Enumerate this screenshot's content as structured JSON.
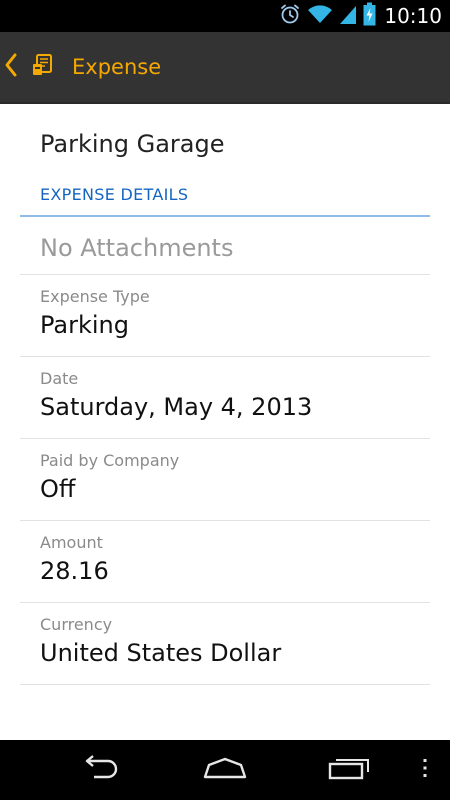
{
  "status_bar": {
    "time": "10:10",
    "icons": [
      "alarm-icon",
      "wifi-icon",
      "signal-icon",
      "battery-charging-icon"
    ]
  },
  "action_bar": {
    "title": "Expense",
    "title_color": "#f5a800",
    "icons": [
      "back-chevron-icon",
      "app-expense-icon"
    ]
  },
  "record": {
    "title": "Parking Garage",
    "section_header": "EXPENSE DETAILS",
    "attachments_label": "No Attachments",
    "fields": [
      {
        "label": "Expense Type",
        "value": "Parking"
      },
      {
        "label": "Date",
        "value": "Saturday, May 4, 2013"
      },
      {
        "label": "Paid by Company",
        "value": "Off"
      },
      {
        "label": "Amount",
        "value": "28.16"
      },
      {
        "label": "Currency",
        "value": "United States Dollar"
      }
    ]
  },
  "nav_bar": {
    "buttons": [
      "back-icon",
      "home-icon",
      "recent-apps-icon",
      "overflow-menu-icon"
    ]
  },
  "colors": {
    "accent": "#f5a800",
    "section_header": "#1565c0",
    "action_bar_bg": "#333333"
  }
}
